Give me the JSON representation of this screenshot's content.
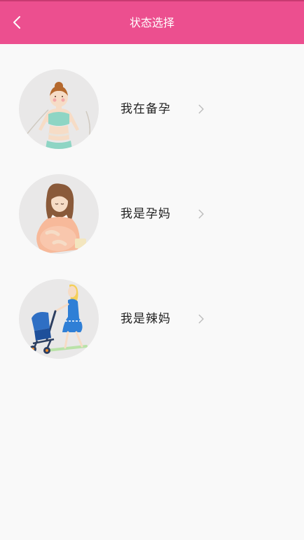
{
  "header": {
    "title": "状态选择",
    "back_icon": "chevron-left-icon",
    "background": "#ec4f8f"
  },
  "states": [
    {
      "label": "我在备孕",
      "avatar": "woman-fitness-measuring-tape-illustration"
    },
    {
      "label": "我是孕妈",
      "avatar": "pregnant-woman-illustration"
    },
    {
      "label": "我是辣妈",
      "avatar": "mother-with-stroller-illustration"
    }
  ],
  "colors": {
    "background": "#f9f9f9",
    "avatar_bg": "#e9e8e8",
    "chevron": "#bbbbbb"
  }
}
